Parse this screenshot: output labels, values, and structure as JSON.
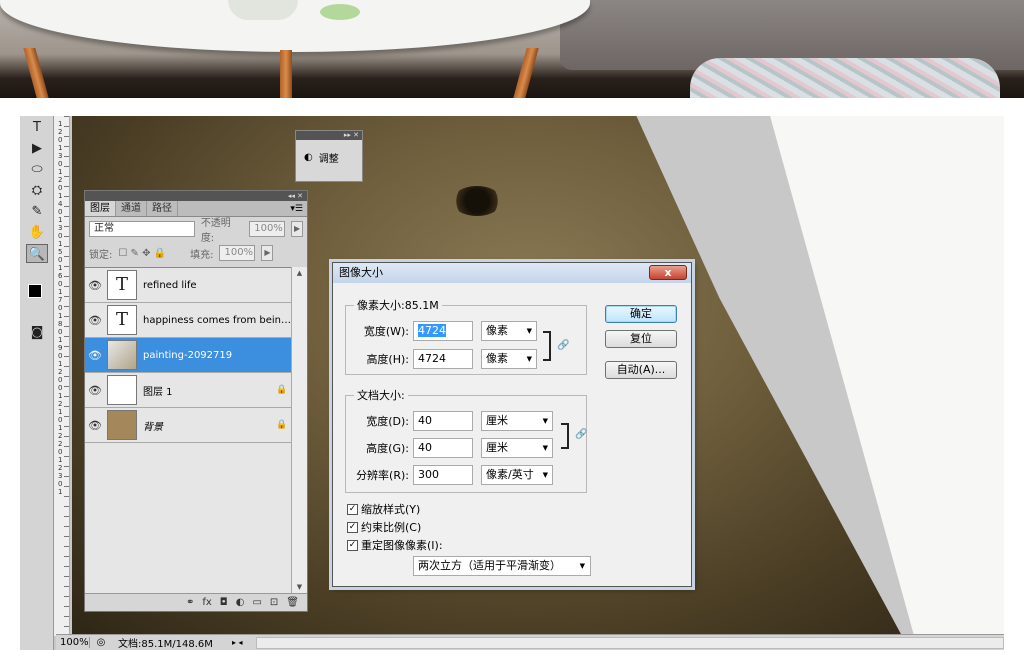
{
  "tools": [
    "T",
    "▶",
    "⬭",
    "⛭",
    "✎",
    "✋",
    "🔍"
  ],
  "ruler_numbers": "12013012014013015016017018019012001210122012301",
  "adjust_panel": {
    "label": "调整",
    "header_icons": "▸▸ ✕"
  },
  "layers_panel": {
    "header_icons": "◂◂ ✕",
    "tabs": [
      "图层",
      "通道",
      "路径"
    ],
    "blend_mode": "正常",
    "opacity_label": "不透明度:",
    "opacity_value": "100%",
    "lock_label": "锁定:",
    "fill_label": "填充:",
    "fill_value": "100%",
    "layers": [
      {
        "name": "refined life",
        "type": "text",
        "selected": false,
        "locked": false
      },
      {
        "name": "happiness comes from being ...",
        "type": "text",
        "selected": false,
        "locked": false
      },
      {
        "name": "painting-2092719",
        "type": "image",
        "selected": true,
        "locked": false
      },
      {
        "name": "图层 1",
        "type": "blank",
        "selected": false,
        "locked": true
      },
      {
        "name": "背景",
        "type": "background",
        "selected": false,
        "locked": true
      }
    ],
    "footer_icons": [
      "⚭",
      "fx",
      "◘",
      "◐",
      "▭",
      "⊡",
      "🗑"
    ]
  },
  "dialog": {
    "title": "图像大小",
    "close": "x",
    "pixel_dimensions": {
      "legend": "像素大小:85.1M",
      "width_label": "宽度(W):",
      "width_value": "4724",
      "width_unit": "像素",
      "height_label": "高度(H):",
      "height_value": "4724",
      "height_unit": "像素"
    },
    "document_size": {
      "legend": "文档大小:",
      "width_label": "宽度(D):",
      "width_value": "40",
      "width_unit": "厘米",
      "height_label": "高度(G):",
      "height_value": "40",
      "height_unit": "厘米",
      "resolution_label": "分辨率(R):",
      "resolution_value": "300",
      "resolution_unit": "像素/英寸"
    },
    "buttons": {
      "ok": "确定",
      "reset": "复位",
      "auto": "自动(A)..."
    },
    "checkboxes": [
      {
        "label": "缩放样式(Y)",
        "checked": true
      },
      {
        "label": "约束比例(C)",
        "checked": true
      },
      {
        "label": "重定图像像素(I):",
        "checked": true
      }
    ],
    "resample_method": "两次立方（适用于平滑渐变）"
  },
  "status_bar": {
    "zoom": "100%",
    "doc_info": "文档:85.1M/148.6M",
    "nav": "▸ ◂"
  },
  "colors": {
    "selected_layer": "#3c8ede",
    "dialog_close": "#c7432e",
    "panel_header": "#545454"
  }
}
